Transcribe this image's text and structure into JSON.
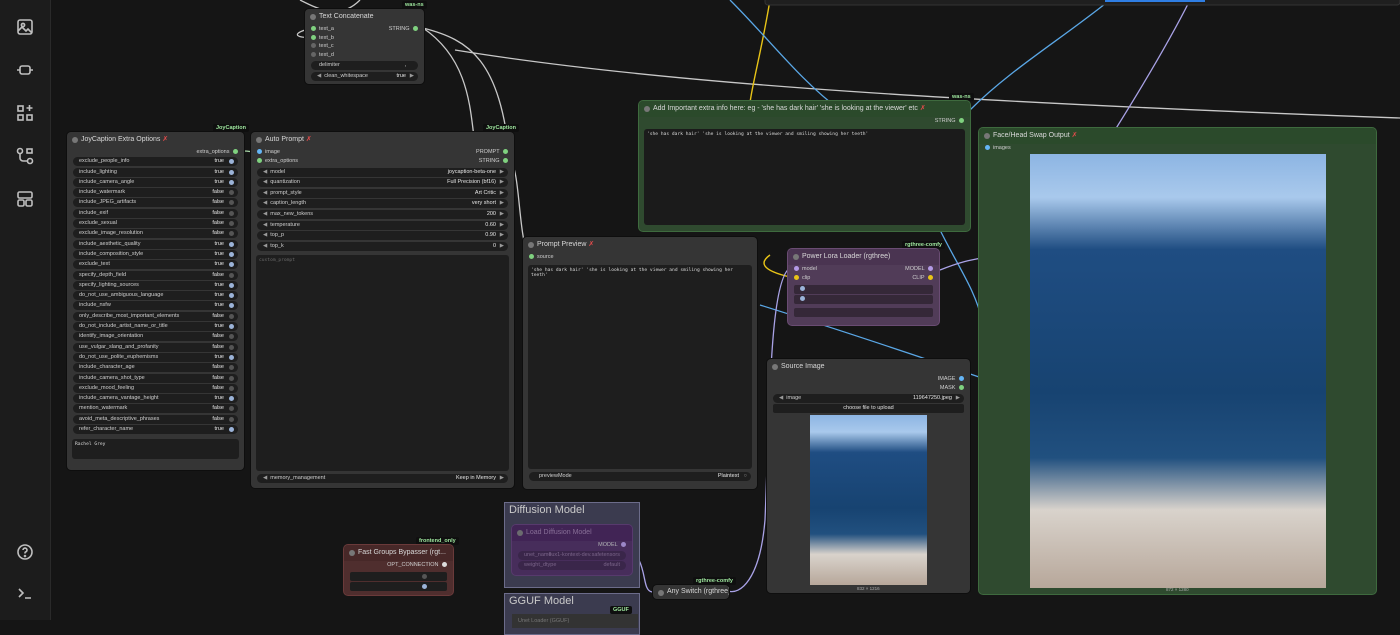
{
  "sidebar": {
    "items": [
      "images-icon",
      "nodes-icon",
      "models-icon",
      "workflows-icon",
      "templates-icon"
    ],
    "bottom": [
      "help-icon",
      "terminal-icon"
    ]
  },
  "badges": {
    "was_ns": "was-ns",
    "joycaption": "JoyCaption",
    "rgthree": "rgthree-comfy",
    "frontend_only": "frontend_only",
    "gguf": "GGUF"
  },
  "text_concat": {
    "title": "Text Concatenate",
    "inputs": [
      "text_a",
      "text_b",
      "text_c",
      "text_d"
    ],
    "output": "STRING",
    "delimiter_label": "delimiter",
    "delimiter_value": ",",
    "clean_label": "clean_whitespace",
    "clean_value": "true"
  },
  "joy_extra": {
    "title": "JoyCaption Extra Options",
    "output": "extra_options",
    "options": [
      {
        "label": "exclude_people_info",
        "value": "true"
      },
      {
        "label": "include_lighting",
        "value": "true"
      },
      {
        "label": "include_camera_angle",
        "value": "true"
      },
      {
        "label": "include_watermark",
        "value": "false"
      },
      {
        "label": "include_JPEG_artifacts",
        "value": "false"
      },
      {
        "label": "include_exif",
        "value": "false"
      },
      {
        "label": "exclude_sexual",
        "value": "false"
      },
      {
        "label": "exclude_image_resolution",
        "value": "false"
      },
      {
        "label": "include_aesthetic_quality",
        "value": "true"
      },
      {
        "label": "include_composition_style",
        "value": "true"
      },
      {
        "label": "exclude_text",
        "value": "true"
      },
      {
        "label": "specify_depth_field",
        "value": "false"
      },
      {
        "label": "specify_lighting_sources",
        "value": "true"
      },
      {
        "label": "do_not_use_ambiguous_language",
        "value": "true"
      },
      {
        "label": "include_nsfw",
        "value": "true"
      },
      {
        "label": "only_describe_most_important_elements",
        "value": "false"
      },
      {
        "label": "do_not_include_artist_name_or_title",
        "value": "true"
      },
      {
        "label": "identify_image_orientation",
        "value": "false"
      },
      {
        "label": "use_vulgar_slang_and_profanity",
        "value": "false"
      },
      {
        "label": "do_not_use_polite_euphemisms",
        "value": "true"
      },
      {
        "label": "include_character_age",
        "value": "false"
      },
      {
        "label": "include_camera_shot_type",
        "value": "false"
      },
      {
        "label": "exclude_mood_feeling",
        "value": "false"
      },
      {
        "label": "include_camera_vantage_height",
        "value": "true"
      },
      {
        "label": "mention_watermark",
        "value": "false"
      },
      {
        "label": "avoid_meta_descriptive_phrases",
        "value": "false"
      },
      {
        "label": "refer_character_name",
        "value": "true"
      }
    ],
    "character_name": "Rachel Grey"
  },
  "auto_prompt": {
    "title": "Auto Prompt",
    "inputs": [
      "image",
      "extra_options"
    ],
    "outputs": [
      "PROMPT",
      "STRING"
    ],
    "widgets": [
      {
        "label": "model",
        "value": "joycaption-beta-one"
      },
      {
        "label": "quantization",
        "value": "Full Precision (bf16)"
      },
      {
        "label": "prompt_style",
        "value": "Art Critic"
      },
      {
        "label": "caption_length",
        "value": "very short"
      },
      {
        "label": "max_new_tokens",
        "value": "200"
      },
      {
        "label": "temperature",
        "value": "0.60"
      },
      {
        "label": "top_p",
        "value": "0.90"
      },
      {
        "label": "top_k",
        "value": "0"
      }
    ],
    "placeholder": "custom_prompt",
    "memory_label": "memory_management",
    "memory_value": "Keep in Memory"
  },
  "extra_info": {
    "title": "Add Important extra info here: eg - 'she has dark hair' 'she is looking at the viewer' etc",
    "output": "STRING",
    "text": "'she has dark hair' 'she is looking at the viewer and smiling showing her teeth'"
  },
  "prompt_preview": {
    "title": "Prompt Preview",
    "input": "source",
    "text": "'she has dark hair' 'she is looking at the viewer and smiling showing her teeth'",
    "mode_label": "previewMode",
    "mode_value": "Plaintext"
  },
  "power_lora": {
    "title": "Power Lora Loader (rgthree)",
    "inputs": [
      "model",
      "clip"
    ],
    "outputs": [
      "MODEL",
      "CLIP"
    ]
  },
  "source_image": {
    "title": "Source Image",
    "outputs": [
      "IMAGE",
      "MASK"
    ],
    "image_label": "image",
    "image_value": "119647250.jpeg",
    "upload_label": "choose file to upload",
    "dims": "832 × 1216"
  },
  "face_swap": {
    "title": "Face/Head Swap Output",
    "input": "images",
    "dims": "872 × 1280"
  },
  "fast_bypasser": {
    "title": "Fast Groups Bypasser (rgt...",
    "output": "OPT_CONNECTION"
  },
  "diffusion_group": {
    "title": "Diffusion Model",
    "node_title": "Load Diffusion Model",
    "output": "MODEL",
    "w1_label": "unet_name",
    "w1_value": "flux1-kontext-dev.safetensors",
    "w2_label": "weight_dtype",
    "w2_value": "default"
  },
  "gguf_group": {
    "title": "GGUF Model",
    "node_title": "Unet Loader (GGUF)"
  },
  "any_switch": {
    "title": "Any Switch (rgthree)"
  }
}
